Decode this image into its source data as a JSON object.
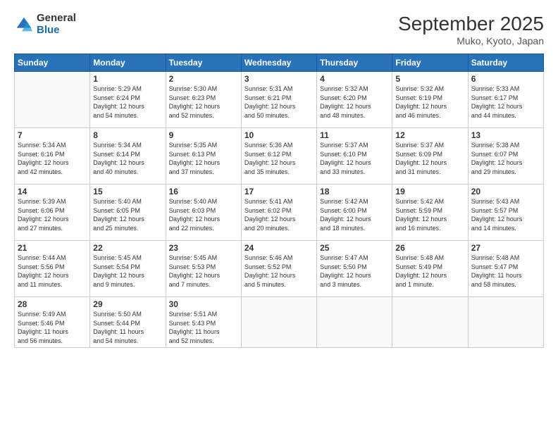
{
  "logo": {
    "general": "General",
    "blue": "Blue"
  },
  "header": {
    "title": "September 2025",
    "subtitle": "Muko, Kyoto, Japan"
  },
  "days_of_week": [
    "Sunday",
    "Monday",
    "Tuesday",
    "Wednesday",
    "Thursday",
    "Friday",
    "Saturday"
  ],
  "weeks": [
    [
      {
        "day": "",
        "info": ""
      },
      {
        "day": "1",
        "info": "Sunrise: 5:29 AM\nSunset: 6:24 PM\nDaylight: 12 hours\nand 54 minutes."
      },
      {
        "day": "2",
        "info": "Sunrise: 5:30 AM\nSunset: 6:23 PM\nDaylight: 12 hours\nand 52 minutes."
      },
      {
        "day": "3",
        "info": "Sunrise: 5:31 AM\nSunset: 6:21 PM\nDaylight: 12 hours\nand 50 minutes."
      },
      {
        "day": "4",
        "info": "Sunrise: 5:32 AM\nSunset: 6:20 PM\nDaylight: 12 hours\nand 48 minutes."
      },
      {
        "day": "5",
        "info": "Sunrise: 5:32 AM\nSunset: 6:19 PM\nDaylight: 12 hours\nand 46 minutes."
      },
      {
        "day": "6",
        "info": "Sunrise: 5:33 AM\nSunset: 6:17 PM\nDaylight: 12 hours\nand 44 minutes."
      }
    ],
    [
      {
        "day": "7",
        "info": "Sunrise: 5:34 AM\nSunset: 6:16 PM\nDaylight: 12 hours\nand 42 minutes."
      },
      {
        "day": "8",
        "info": "Sunrise: 5:34 AM\nSunset: 6:14 PM\nDaylight: 12 hours\nand 40 minutes."
      },
      {
        "day": "9",
        "info": "Sunrise: 5:35 AM\nSunset: 6:13 PM\nDaylight: 12 hours\nand 37 minutes."
      },
      {
        "day": "10",
        "info": "Sunrise: 5:36 AM\nSunset: 6:12 PM\nDaylight: 12 hours\nand 35 minutes."
      },
      {
        "day": "11",
        "info": "Sunrise: 5:37 AM\nSunset: 6:10 PM\nDaylight: 12 hours\nand 33 minutes."
      },
      {
        "day": "12",
        "info": "Sunrise: 5:37 AM\nSunset: 6:09 PM\nDaylight: 12 hours\nand 31 minutes."
      },
      {
        "day": "13",
        "info": "Sunrise: 5:38 AM\nSunset: 6:07 PM\nDaylight: 12 hours\nand 29 minutes."
      }
    ],
    [
      {
        "day": "14",
        "info": "Sunrise: 5:39 AM\nSunset: 6:06 PM\nDaylight: 12 hours\nand 27 minutes."
      },
      {
        "day": "15",
        "info": "Sunrise: 5:40 AM\nSunset: 6:05 PM\nDaylight: 12 hours\nand 25 minutes."
      },
      {
        "day": "16",
        "info": "Sunrise: 5:40 AM\nSunset: 6:03 PM\nDaylight: 12 hours\nand 22 minutes."
      },
      {
        "day": "17",
        "info": "Sunrise: 5:41 AM\nSunset: 6:02 PM\nDaylight: 12 hours\nand 20 minutes."
      },
      {
        "day": "18",
        "info": "Sunrise: 5:42 AM\nSunset: 6:00 PM\nDaylight: 12 hours\nand 18 minutes."
      },
      {
        "day": "19",
        "info": "Sunrise: 5:42 AM\nSunset: 5:59 PM\nDaylight: 12 hours\nand 16 minutes."
      },
      {
        "day": "20",
        "info": "Sunrise: 5:43 AM\nSunset: 5:57 PM\nDaylight: 12 hours\nand 14 minutes."
      }
    ],
    [
      {
        "day": "21",
        "info": "Sunrise: 5:44 AM\nSunset: 5:56 PM\nDaylight: 12 hours\nand 11 minutes."
      },
      {
        "day": "22",
        "info": "Sunrise: 5:45 AM\nSunset: 5:54 PM\nDaylight: 12 hours\nand 9 minutes."
      },
      {
        "day": "23",
        "info": "Sunrise: 5:45 AM\nSunset: 5:53 PM\nDaylight: 12 hours\nand 7 minutes."
      },
      {
        "day": "24",
        "info": "Sunrise: 5:46 AM\nSunset: 5:52 PM\nDaylight: 12 hours\nand 5 minutes."
      },
      {
        "day": "25",
        "info": "Sunrise: 5:47 AM\nSunset: 5:50 PM\nDaylight: 12 hours\nand 3 minutes."
      },
      {
        "day": "26",
        "info": "Sunrise: 5:48 AM\nSunset: 5:49 PM\nDaylight: 12 hours\nand 1 minute."
      },
      {
        "day": "27",
        "info": "Sunrise: 5:48 AM\nSunset: 5:47 PM\nDaylight: 11 hours\nand 58 minutes."
      }
    ],
    [
      {
        "day": "28",
        "info": "Sunrise: 5:49 AM\nSunset: 5:46 PM\nDaylight: 11 hours\nand 56 minutes."
      },
      {
        "day": "29",
        "info": "Sunrise: 5:50 AM\nSunset: 5:44 PM\nDaylight: 11 hours\nand 54 minutes."
      },
      {
        "day": "30",
        "info": "Sunrise: 5:51 AM\nSunset: 5:43 PM\nDaylight: 11 hours\nand 52 minutes."
      },
      {
        "day": "",
        "info": ""
      },
      {
        "day": "",
        "info": ""
      },
      {
        "day": "",
        "info": ""
      },
      {
        "day": "",
        "info": ""
      }
    ]
  ]
}
